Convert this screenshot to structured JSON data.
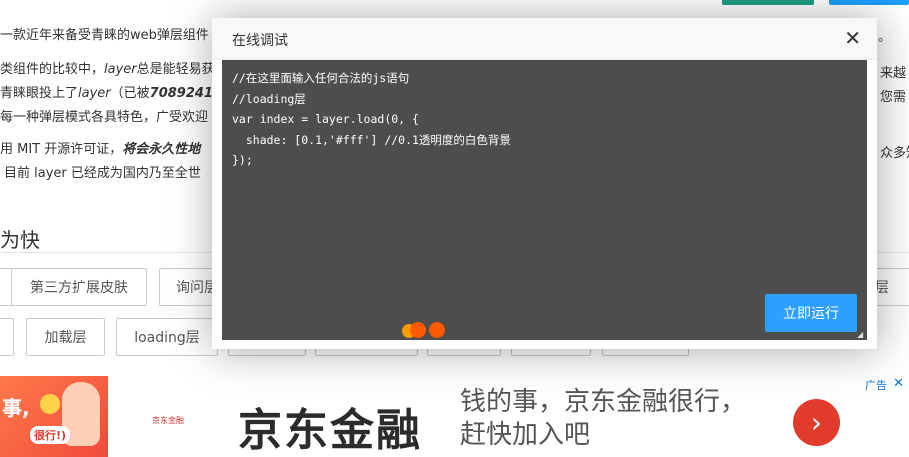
{
  "top_actions": {
    "green_color": "#1e9e86",
    "blue_color": "#1e9fff"
  },
  "article": {
    "line1": "一款近年来备受青睐的web弹层组件",
    "line2_a": "类组件的比较中，",
    "line2_layer": "layer",
    "line2_b": "总是能轻易获",
    "line3_a": "青睐眼投上了",
    "line3_layer": "layer",
    "line3_b": "（已被",
    "line3_num": "7089241",
    "line4": "每一种弹层模式各具特色，广受欢迎",
    "line5_a": "用 MIT 开源许可证，",
    "line5_em": "将会永久性地",
    "line6": "目前 layer 已经成为国内乃至全世",
    "right1": "。",
    "right2": "来越",
    "right3": "您需",
    "right5": "众多知"
  },
  "section": {
    "title": "为快"
  },
  "demo_buttons_row1": [
    "第三方扩展皮肤",
    "询问层",
    "层"
  ],
  "demo_buttons_row2": [
    "加载层",
    "loading层"
  ],
  "dialog": {
    "title": "在线调试",
    "close_glyph": "✕",
    "code": "//在这里面输入任何合法的js语句\n//loading层\nvar index = layer.load(0, {\n  shade: [0.1,'#fff'] //0.1透明度的白色背景\n});",
    "run_label": "立即运行"
  },
  "ad": {
    "left_text": "事,",
    "left_pill": "很行!)",
    "logo_text": "京东金融",
    "brand": "京东金融",
    "slogan": "钱的事，京东金融很行，赶快加入吧",
    "arrow_glyph": "›",
    "tag": "广告",
    "close_glyph": "✕"
  }
}
